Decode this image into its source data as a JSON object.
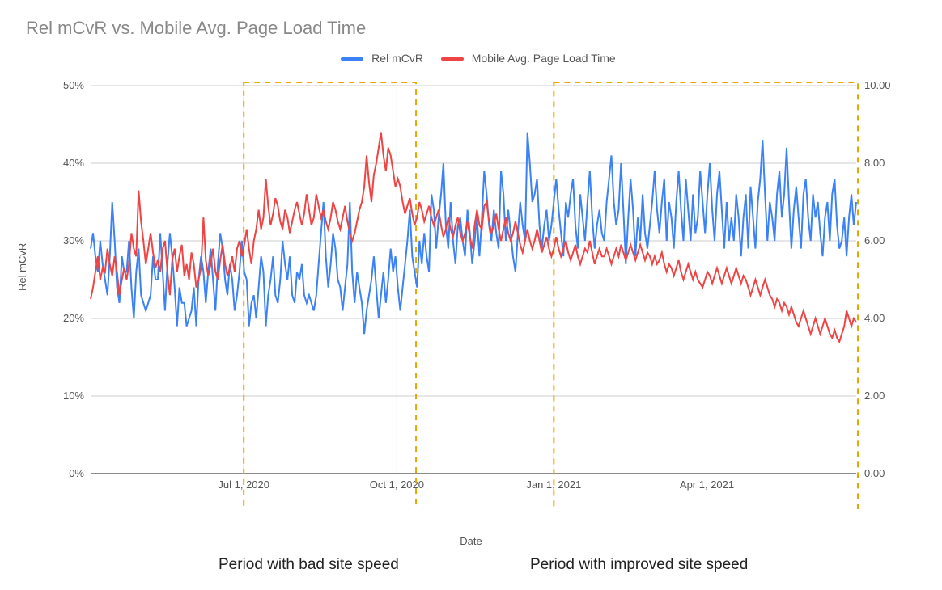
{
  "title": "Rel mCvR vs. Mobile Avg. Page Load Time",
  "legend": {
    "series1": "Rel mCvR",
    "series2": "Mobile Avg. Page Load Time"
  },
  "axes": {
    "xlabel": "Date",
    "y1label": "Rel mCvR",
    "y1_ticks": [
      "0%",
      "10%",
      "20%",
      "30%",
      "40%",
      "50%"
    ],
    "y2_ticks": [
      "0.00",
      "2.00",
      "4.00",
      "6.00",
      "8.00",
      "10.00"
    ],
    "x_ticks": [
      "Jul 1, 2020",
      "Oct 1, 2020",
      "Jan 1, 2021",
      "Apr 1, 2021"
    ]
  },
  "annotations": {
    "left": "Period with bad site speed",
    "right": "Period with improved site speed"
  },
  "chart_data": {
    "type": "line",
    "title": "Rel mCvR vs. Mobile Avg. Page Load Time",
    "xlabel": "Date",
    "y1label": "Rel mCvR",
    "y1_range": [
      0,
      50
    ],
    "y1_unit": "%",
    "y2_range": [
      0,
      10
    ],
    "y2_unit": "seconds",
    "x_range": [
      "2020-04-01",
      "2021-07-01"
    ],
    "x_ticks": [
      "Jul 1, 2020",
      "Oct 1, 2020",
      "Jan 1, 2021",
      "Apr 1, 2021"
    ],
    "highlight_periods": [
      {
        "label": "Period with bad site speed",
        "start": "2020-07-01",
        "end": "2020-10-10"
      },
      {
        "label": "Period with improved site speed",
        "start": "2021-01-01",
        "end": "2021-07-01"
      }
    ],
    "legend_position": "top",
    "grid": true,
    "series": [
      {
        "name": "Rel mCvR",
        "axis": "y1",
        "color": "#3b82f6",
        "values_note": "values in percent; daily; approximate trace",
        "values": [
          29,
          31,
          28,
          26,
          30,
          27,
          25,
          23,
          28,
          35,
          30,
          24,
          22,
          28,
          26,
          26,
          30,
          24,
          20,
          26,
          29,
          23,
          22,
          21,
          22,
          23,
          28,
          25,
          25,
          31,
          26,
          21,
          27,
          31,
          28,
          24,
          19,
          24,
          22,
          22,
          19,
          20,
          21,
          24,
          19,
          25,
          28,
          26,
          22,
          26,
          29,
          25,
          21,
          27,
          31,
          29,
          25,
          23,
          27,
          25,
          21,
          23,
          26,
          30,
          26,
          25,
          19,
          22,
          23,
          20,
          24,
          28,
          26,
          19,
          23,
          25,
          28,
          23,
          22,
          25,
          30,
          27,
          25,
          28,
          23,
          22,
          26,
          25,
          27,
          23,
          22,
          23,
          22,
          21,
          23,
          27,
          31,
          35,
          28,
          24,
          27,
          31,
          29,
          25,
          24,
          21,
          24,
          27,
          35,
          26,
          22,
          26,
          24,
          22,
          18,
          21,
          23,
          25,
          28,
          24,
          20,
          23,
          26,
          22,
          25,
          29,
          26,
          28,
          24,
          21,
          24,
          27,
          30,
          34,
          28,
          26,
          24,
          30,
          27,
          31,
          28,
          26,
          36,
          34,
          29,
          33,
          36,
          40,
          32,
          29,
          35,
          30,
          27,
          32,
          33,
          30,
          28,
          34,
          31,
          27,
          30,
          33,
          28,
          33,
          39,
          36,
          32,
          30,
          34,
          31,
          29,
          39,
          36,
          30,
          34,
          31,
          28,
          26,
          31,
          35,
          32,
          30,
          44,
          40,
          35,
          36,
          38,
          32,
          29,
          32,
          34,
          30,
          32,
          35,
          38,
          34,
          31,
          28,
          35,
          33,
          36,
          38,
          32,
          29,
          36,
          33,
          30,
          35,
          39,
          33,
          29,
          32,
          34,
          31,
          30,
          35,
          38,
          41,
          35,
          32,
          34,
          40,
          34,
          27,
          33,
          38,
          34,
          28,
          33,
          30,
          36,
          31,
          29,
          32,
          35,
          39,
          34,
          31,
          35,
          38,
          30,
          35,
          33,
          29,
          35,
          39,
          34,
          30,
          38,
          34,
          30,
          36,
          31,
          33,
          39,
          35,
          31,
          36,
          40,
          34,
          30,
          36,
          39,
          34,
          29,
          35,
          30,
          33,
          30,
          36,
          33,
          28,
          33,
          36,
          29,
          37,
          33,
          29,
          35,
          38,
          43,
          36,
          30,
          35,
          33,
          30,
          36,
          39,
          33,
          36,
          42,
          35,
          29,
          34,
          37,
          33,
          29,
          36,
          38,
          33,
          30,
          36,
          33,
          35,
          31,
          28,
          33,
          35,
          30,
          36,
          38,
          32,
          29,
          30,
          33,
          28,
          33,
          36,
          32,
          35
        ]
      },
      {
        "name": "Mobile Avg. Page Load Time",
        "axis": "y2",
        "color": "#ef4444",
        "values_note": "values in seconds; daily; approximate trace",
        "values": [
          4.5,
          4.8,
          5.2,
          5.6,
          5.0,
          5.3,
          5.2,
          5.8,
          5.4,
          5.1,
          5.6,
          5.2,
          4.6,
          5.0,
          5.3,
          5.0,
          5.4,
          6.2,
          5.8,
          5.6,
          7.3,
          6.5,
          6.0,
          5.4,
          5.8,
          6.2,
          5.7,
          5.3,
          5.5,
          5.2,
          5.8,
          6.0,
          5.2,
          4.6,
          5.5,
          5.8,
          5.2,
          5.6,
          5.9,
          5.1,
          5.4,
          5.0,
          5.7,
          5.4,
          4.8,
          5.0,
          5.3,
          6.6,
          5.5,
          5.1,
          5.4,
          5.8,
          5.2,
          5.0,
          5.5,
          5.9,
          5.4,
          5.1,
          5.3,
          5.6,
          5.2,
          5.8,
          6.0,
          5.6,
          5.9,
          6.3,
          5.8,
          5.4,
          6.0,
          6.3,
          6.8,
          6.3,
          6.6,
          7.6,
          6.9,
          6.4,
          6.7,
          7.1,
          6.9,
          6.5,
          6.3,
          6.8,
          6.6,
          6.2,
          6.5,
          6.8,
          7.0,
          6.7,
          6.4,
          6.7,
          7.2,
          6.8,
          6.4,
          6.6,
          7.2,
          6.9,
          6.6,
          6.8,
          6.5,
          6.3,
          6.6,
          7.0,
          6.8,
          6.5,
          6.3,
          6.6,
          6.9,
          6.5,
          6.2,
          6.0,
          6.2,
          6.5,
          6.8,
          7.0,
          7.4,
          8.2,
          7.5,
          7.0,
          7.7,
          8.0,
          8.4,
          8.8,
          8.2,
          7.8,
          8.4,
          8.2,
          7.8,
          7.4,
          7.6,
          7.4,
          7.0,
          6.7,
          6.9,
          7.1,
          6.7,
          6.4,
          6.6,
          7.0,
          6.8,
          6.5,
          6.7,
          6.9,
          6.6,
          6.4,
          6.6,
          6.8,
          6.4,
          6.1,
          6.3,
          6.6,
          6.3,
          6.1,
          6.4,
          6.6,
          6.2,
          6.0,
          6.2,
          6.5,
          6.1,
          5.8,
          6.4,
          6.8,
          6.4,
          6.3,
          6.9,
          7.0,
          6.5,
          6.2,
          6.4,
          6.7,
          6.3,
          6.0,
          6.3,
          6.6,
          6.2,
          6.0,
          6.2,
          6.5,
          6.2,
          5.9,
          5.7,
          6.0,
          6.3,
          6.0,
          5.8,
          6.0,
          6.3,
          6.0,
          5.7,
          5.9,
          6.1,
          5.8,
          5.6,
          5.8,
          6.1,
          5.8,
          5.6,
          5.8,
          6.0,
          5.7,
          5.5,
          5.7,
          5.9,
          5.6,
          5.4,
          5.6,
          5.8,
          5.7,
          6.0,
          5.7,
          5.4,
          5.6,
          5.8,
          5.6,
          5.6,
          5.8,
          5.6,
          5.4,
          5.6,
          5.8,
          5.6,
          5.9,
          5.7,
          5.5,
          5.7,
          5.9,
          5.7,
          5.5,
          5.7,
          5.9,
          5.7,
          5.5,
          5.7,
          5.6,
          5.4,
          5.6,
          5.4,
          5.5,
          5.7,
          5.4,
          5.2,
          5.4,
          5.3,
          5.1,
          5.3,
          5.5,
          5.2,
          5.0,
          5.2,
          5.4,
          5.2,
          5.0,
          5.2,
          5.0,
          4.9,
          4.8,
          5.0,
          5.2,
          5.1,
          4.9,
          5.1,
          5.3,
          5.1,
          4.9,
          5.1,
          5.3,
          5.1,
          4.9,
          5.1,
          5.3,
          5.1,
          4.9,
          5.1,
          5.0,
          4.8,
          4.6,
          4.8,
          5.0,
          4.8,
          4.6,
          4.8,
          5.0,
          4.8,
          4.6,
          4.5,
          4.3,
          4.5,
          4.4,
          4.2,
          4.4,
          4.3,
          4.1,
          4.3,
          4.1,
          3.9,
          3.8,
          4.0,
          4.2,
          4.0,
          3.8,
          3.6,
          3.8,
          4.0,
          3.8,
          3.6,
          3.8,
          4.0,
          3.8,
          3.6,
          3.5,
          3.7,
          3.5,
          3.4,
          3.6,
          3.8,
          4.2,
          4.0,
          3.8,
          4.0,
          3.9
        ]
      }
    ]
  }
}
